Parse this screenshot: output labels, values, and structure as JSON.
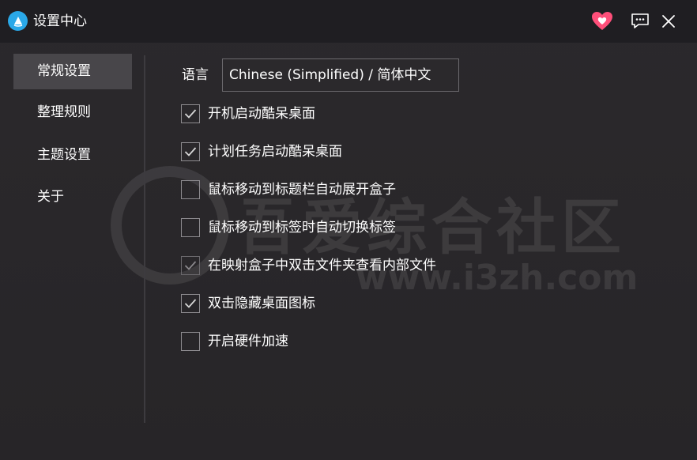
{
  "window": {
    "title": "设置中心"
  },
  "titlebar": {
    "icons": [
      "app-logo-icon",
      "heart-icon",
      "feedback-icon",
      "close-icon"
    ],
    "heart_color": "#ff4f7a",
    "logo_color": "#2aa8e8"
  },
  "sidebar": {
    "items": [
      {
        "label": "常规设置",
        "active": true
      },
      {
        "label": "整理规则",
        "active": false
      },
      {
        "label": "主题设置",
        "active": false
      },
      {
        "label": "关于",
        "active": false
      }
    ]
  },
  "general": {
    "language_label": "语言",
    "language_value": "Chinese (Simplified) / 简体中文",
    "options": [
      {
        "label": "开机启动酷呆桌面",
        "checked": true
      },
      {
        "label": "计划任务启动酷呆桌面",
        "checked": true
      },
      {
        "label": "鼠标移动到标题栏自动展开盒子",
        "checked": false
      },
      {
        "label": "鼠标移动到标签时自动切换标签",
        "checked": false
      },
      {
        "label": "在映射盒子中双击文件夹查看内部文件",
        "checked": true,
        "disabled": true
      },
      {
        "label": "双击隐藏桌面图标",
        "checked": true
      },
      {
        "label": "开启硬件加速",
        "checked": false
      }
    ]
  },
  "watermark": {
    "text": "吾爱综合社区",
    "url": "www.i3zh.com"
  }
}
